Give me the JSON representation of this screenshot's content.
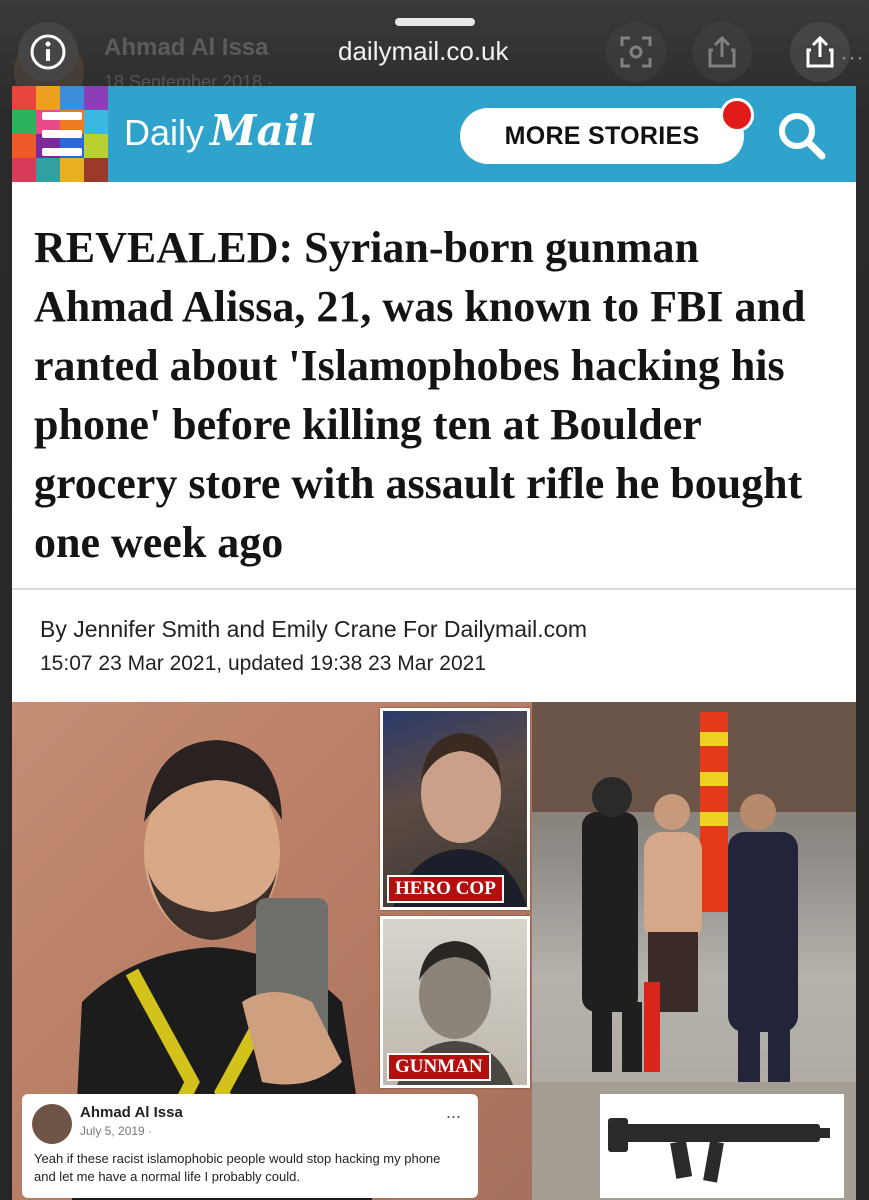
{
  "browser": {
    "url": "dailymail.co.uk",
    "behind_post_author": "Ahmad Al Issa",
    "behind_post_date": "18 September 2018 ·",
    "icons": [
      "info-icon",
      "scan-icon",
      "share-icon",
      "share-icon"
    ]
  },
  "header": {
    "brand_daily": "Daily",
    "brand_mail": "Mail",
    "more_stories_label": "MORE STORIES",
    "brand_color": "#2fa3cc",
    "notification_color": "#e11a1a"
  },
  "article": {
    "headline": "REVEALED: Syrian-born gunman Ahmad Alissa, 21, was known to FBI and ranted about 'Islamophobes hacking his phone' before killing ten at Boulder grocery store with assault rifle he bought one week ago",
    "byline": "By Jennifer Smith and Emily Crane For Dailymail.com",
    "dateline": "15:07 23 Mar 2021, updated 19:38 23 Mar 2021"
  },
  "collage": {
    "inset_cop_label": "HERO COP",
    "inset_gunman_label": "GUNMAN",
    "fb_post": {
      "author": "Ahmad Al Issa",
      "date": "July 5, 2019 ·",
      "more": "...",
      "text": "Yeah if these racist islamophobic people would stop hacking my phone and let me have a normal life I probably could."
    }
  }
}
